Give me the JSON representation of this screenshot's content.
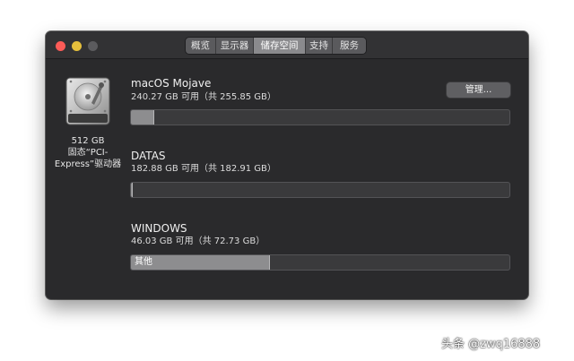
{
  "window": {
    "traffic_lights": {
      "close_color": "#fc5b57",
      "minimize_color": "#e5bf3c",
      "zoom_color": "#5b5b5e"
    },
    "tabs": [
      {
        "label": "概览"
      },
      {
        "label": "显示器"
      },
      {
        "label": "储存空间",
        "active": true
      },
      {
        "label": "支持"
      },
      {
        "label": "服务"
      }
    ]
  },
  "drive": {
    "icon": "hard-drive-icon",
    "caption_line1": "512 GB",
    "caption_line2": "固态“PCI-",
    "caption_line3": "Express”驱动器"
  },
  "manage_button": {
    "label": "管理..."
  },
  "volumes": [
    {
      "name": "macOS Mojave",
      "info": "240.27 GB 可用（共 255.85 GB）",
      "used_fraction": 0.061,
      "bar_label": ""
    },
    {
      "name": "DATAS",
      "info": "182.88 GB 可用（共 182.91 GB）",
      "used_fraction": 0.002,
      "bar_label": ""
    },
    {
      "name": "WINDOWS",
      "info": "46.03 GB 可用（共 72.73 GB）",
      "used_fraction": 0.367,
      "bar_label": "其他"
    }
  ],
  "watermark": {
    "text": "头条 @zwq16888"
  }
}
